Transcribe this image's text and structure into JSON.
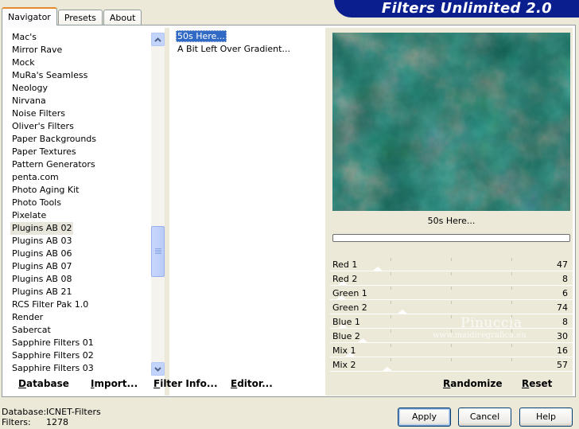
{
  "tabs": [
    {
      "label": "Navigator",
      "active": true
    },
    {
      "label": "Presets",
      "active": false
    },
    {
      "label": "About",
      "active": false
    }
  ],
  "banner": {
    "title": "Filters Unlimited 2.0"
  },
  "categories": {
    "items": [
      "Mac's",
      "Mirror Rave",
      "Mock",
      "MuRa's Seamless",
      "Neology",
      "Nirvana",
      "Noise Filters",
      "Oliver's Filters",
      "Paper Backgrounds",
      "Paper Textures",
      "Pattern Generators",
      "penta.com",
      "Photo Aging Kit",
      "Photo Tools",
      "Pixelate",
      "Plugins AB 02",
      "Plugins AB 03",
      "Plugins AB 06",
      "Plugins AB 07",
      "Plugins AB 08",
      "Plugins AB 21",
      "RCS Filter Pak 1.0",
      "Render",
      "Sabercat",
      "Sapphire Filters 01",
      "Sapphire Filters 02",
      "Sapphire Filters 03"
    ],
    "selected": "Plugins AB 02",
    "scroll_position": 0.68
  },
  "filters": {
    "items": [
      "50s Here...",
      "A Bit Left Over Gradient..."
    ],
    "selected": "50s Here..."
  },
  "preview": {
    "filter_name": "50s Here...",
    "progress": 0
  },
  "sliders": [
    {
      "label": "Red 1",
      "value": "47"
    },
    {
      "label": "Red 2",
      "value": "8"
    },
    {
      "label": "Green 1",
      "value": "6"
    },
    {
      "label": "Green 2",
      "value": "74"
    },
    {
      "label": "Blue 1",
      "value": "8"
    },
    {
      "label": "Blue 2",
      "value": "30"
    },
    {
      "label": "Mix 1",
      "value": "16"
    },
    {
      "label": "Mix 2",
      "value": "57"
    }
  ],
  "toolbar": {
    "database": "Database",
    "import": "Import...",
    "filter_info": "Filter Info...",
    "editor": "Editor...",
    "randomize": "Randomize",
    "reset": "Reset"
  },
  "status": {
    "database_label": "Database:",
    "database_value": "ICNET-Filters",
    "filters_label": "Filters:",
    "filters_value": "1278"
  },
  "buttons": {
    "apply": "Apply",
    "cancel": "Cancel",
    "help": "Help"
  },
  "watermark": {
    "name": "Pinuccia",
    "url": "www.maidiregrafica.eu"
  },
  "colors": {
    "selection": "#316AC5",
    "banner": "#0A1E8E",
    "tab_accent": "#E68B2C"
  }
}
